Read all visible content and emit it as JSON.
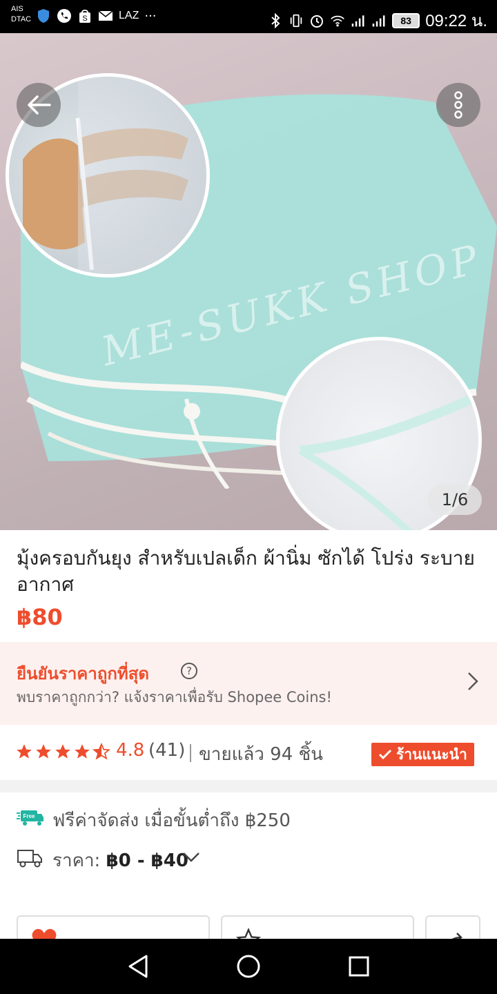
{
  "status_bar": {
    "carrier_1": "AIS",
    "carrier_2": "DTAC",
    "lazada_label": "LAZ",
    "overflow": "···",
    "battery": "83",
    "time": "09:22 น."
  },
  "hero": {
    "watermark": "ME-SUKK SHOP",
    "counter": "1/6"
  },
  "product": {
    "title": "มุ้งครอบกันยุง สำหรับเปลเด็ก ผ้านิ่ม ซักได้ โปร่ง ระบายอากาศ",
    "price": "฿80"
  },
  "guarantee": {
    "title": "ยืนยันราคาถูกที่สุด",
    "help": "?",
    "subtitle": "พบราคาถูกกว่า? แจ้งราคาเพื่อรับ Shopee Coins!"
  },
  "rating": {
    "value": "4.8",
    "stars": 4.8,
    "count": "(41)",
    "sold": "ขายแล้ว 94 ชิ้น",
    "badge": "ร้านแนะนำ"
  },
  "shipping": {
    "free_badge": "Free",
    "free_shipping": "ฟรีค่าจัดส่ง เมื่อขั้นต่ำถึง ฿250",
    "price_label": "ราคา:",
    "price_range": "฿0 - ฿40"
  },
  "colors": {
    "accent": "#ee4d2d",
    "guarantee_bg": "#fdf1ef",
    "net": "#a8e3dc"
  }
}
